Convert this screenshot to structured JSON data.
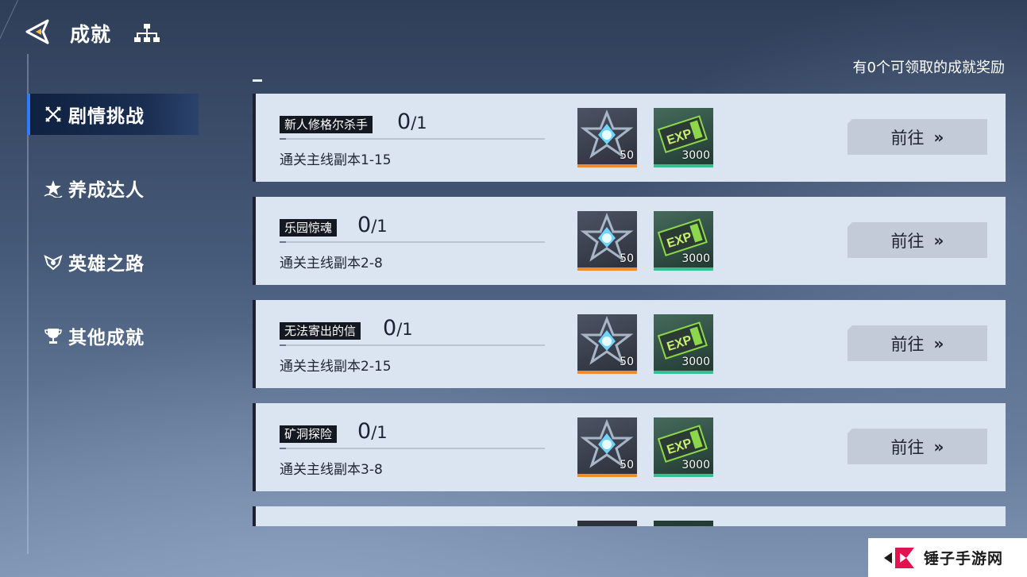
{
  "header": {
    "title": "成就",
    "claim_summary": "有0个可领取的成就奖励"
  },
  "sidebar": {
    "items": [
      {
        "label": "剧情挑战",
        "icon": "crossed-swords-icon",
        "active": true
      },
      {
        "label": "养成达人",
        "icon": "star-wave-icon",
        "active": false
      },
      {
        "label": "英雄之路",
        "icon": "emblem-icon",
        "active": false
      },
      {
        "label": "其他成就",
        "icon": "trophy-icon",
        "active": false
      }
    ]
  },
  "achievements": [
    {
      "name": "新人修格尔杀手",
      "current": "0",
      "total": "/1",
      "progress": 0,
      "desc": "通关主线副本1-15",
      "reward1_qty": "50",
      "reward2_qty": "3000",
      "button": "前往"
    },
    {
      "name": "乐园惊魂",
      "current": "0",
      "total": "/1",
      "progress": 0,
      "desc": "通关主线副本2-8",
      "reward1_qty": "50",
      "reward2_qty": "3000",
      "button": "前往"
    },
    {
      "name": "无法寄出的信",
      "current": "0",
      "total": "/1",
      "progress": 0,
      "desc": "通关主线副本2-15",
      "reward1_qty": "50",
      "reward2_qty": "3000",
      "button": "前往"
    },
    {
      "name": "矿洞探险",
      "current": "0",
      "total": "/1",
      "progress": 0,
      "desc": "通关主线副本3-8",
      "reward1_qty": "50",
      "reward2_qty": "3000",
      "button": "前往"
    }
  ],
  "reward_icons": {
    "reward1": "crystal-star-icon",
    "reward2": "exp-ticket-icon",
    "reward1_accent": "#f08a2c",
    "reward2_accent": "#35c08f"
  },
  "accent_color": "#2f7dff",
  "watermark": {
    "text": "锤子手游网"
  }
}
